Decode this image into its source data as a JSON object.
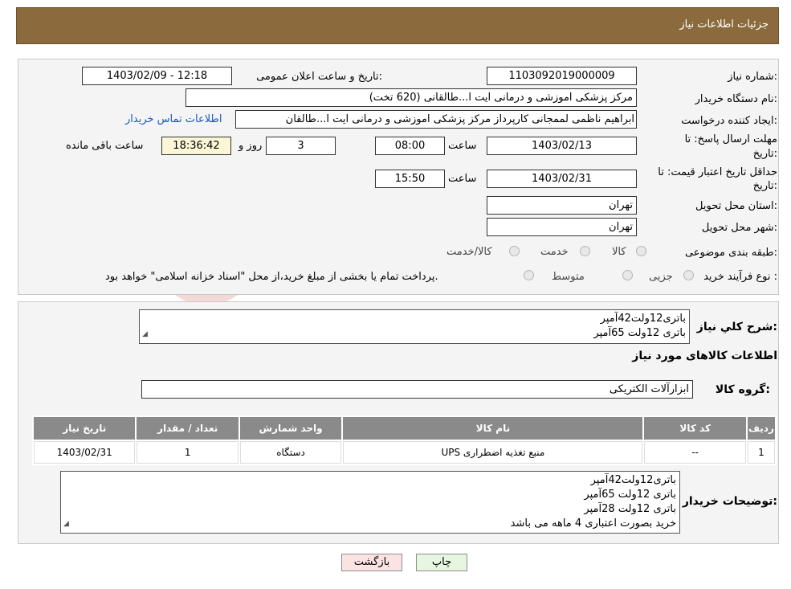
{
  "header": {
    "title": "جزئیات اطلاعات نیاز"
  },
  "fields": {
    "need_number_label": "شماره نیاز:",
    "need_number": "1103092019000009",
    "announce_label": "تاریخ و ساعت اعلان عمومی:",
    "announce_value": "1403/02/09 - 12:18",
    "buyer_org_label": "نام دستگاه خریدار:",
    "buyer_org": "مرکز پزشکی  اموزشی و درمانی ایت ا...طالقانی (620 تخت)",
    "creator_label": "ایجاد کننده درخواست:",
    "creator": "ابراهیم ناظمی لممجانی کارپرداز مرکز پزشکی  اموزشی و درمانی ایت ا...طالقان",
    "contact_link": "اطلاعات تماس خریدار",
    "reply_deadline_label_1": "مهلت ارسال پاسخ: تا",
    "reply_deadline_label_2": "تاریخ:",
    "reply_date": "1403/02/13",
    "hour_label": "ساعت",
    "reply_time": "08:00",
    "days_value": "3",
    "days_label": "روز و",
    "remaining_time": "18:36:42",
    "remaining_label": "ساعت باقی مانده",
    "validity_label_1": "حداقل تاریخ اعتبار قیمت: تا",
    "validity_label_2": "تاریخ:",
    "validity_date": "1403/02/31",
    "validity_hour_label": "ساعت",
    "validity_time": "15:50",
    "province_label": "استان محل تحویل:",
    "province": "تهران",
    "city_label": "شهر محل تحویل:",
    "city": "تهران",
    "category_label": "طبقه بندی موضوعی:",
    "category_options": [
      "کالا",
      "خدمت",
      "کالا/خدمت"
    ],
    "process_label": "نوع فرآیند خرید :",
    "process_options": [
      "جزیی",
      "متوسط"
    ],
    "payment_note": "پرداخت تمام یا بخشی از مبلغ خرید،از محل \"اسناد خزانه اسلامی\" خواهد بود."
  },
  "description": {
    "label": "شرح کلي نياز:",
    "lines": [
      "باتری12ولت42آمپر",
      "باتری 12ولت 65آمپر"
    ]
  },
  "goods_info_title": "اطلاعات کالاهای مورد نیاز",
  "goods_group": {
    "label": "گروه کالا:",
    "value": "ابزارآلات الکتریکی"
  },
  "table": {
    "headers": [
      "ردیف",
      "کد کالا",
      "نام کالا",
      "واحد شمارش",
      "تعداد / مقدار",
      "تاریخ نیاز"
    ],
    "rows": [
      [
        "1",
        "--",
        "منبع تغذیه اضطراری UPS",
        "دستگاه",
        "1",
        "1403/02/31"
      ]
    ]
  },
  "buyer_notes": {
    "label": "توضیحات خریدار:",
    "lines": [
      "باتری12ولت42آمپر",
      "باتری 12ولت 65آمپر",
      "باتری 12ولت 28آمپر",
      "خرید بصورت اعتباری 4 ماهه می باشد"
    ]
  },
  "buttons": {
    "print": "چاپ",
    "back": "بازگشت"
  },
  "colors": {
    "header_bg": "#8b6b3d",
    "link": "#1a56c8",
    "back_bg": "#fbe3e3",
    "print_bg": "#e6f6e0",
    "table_header": "#8a8a8a"
  }
}
